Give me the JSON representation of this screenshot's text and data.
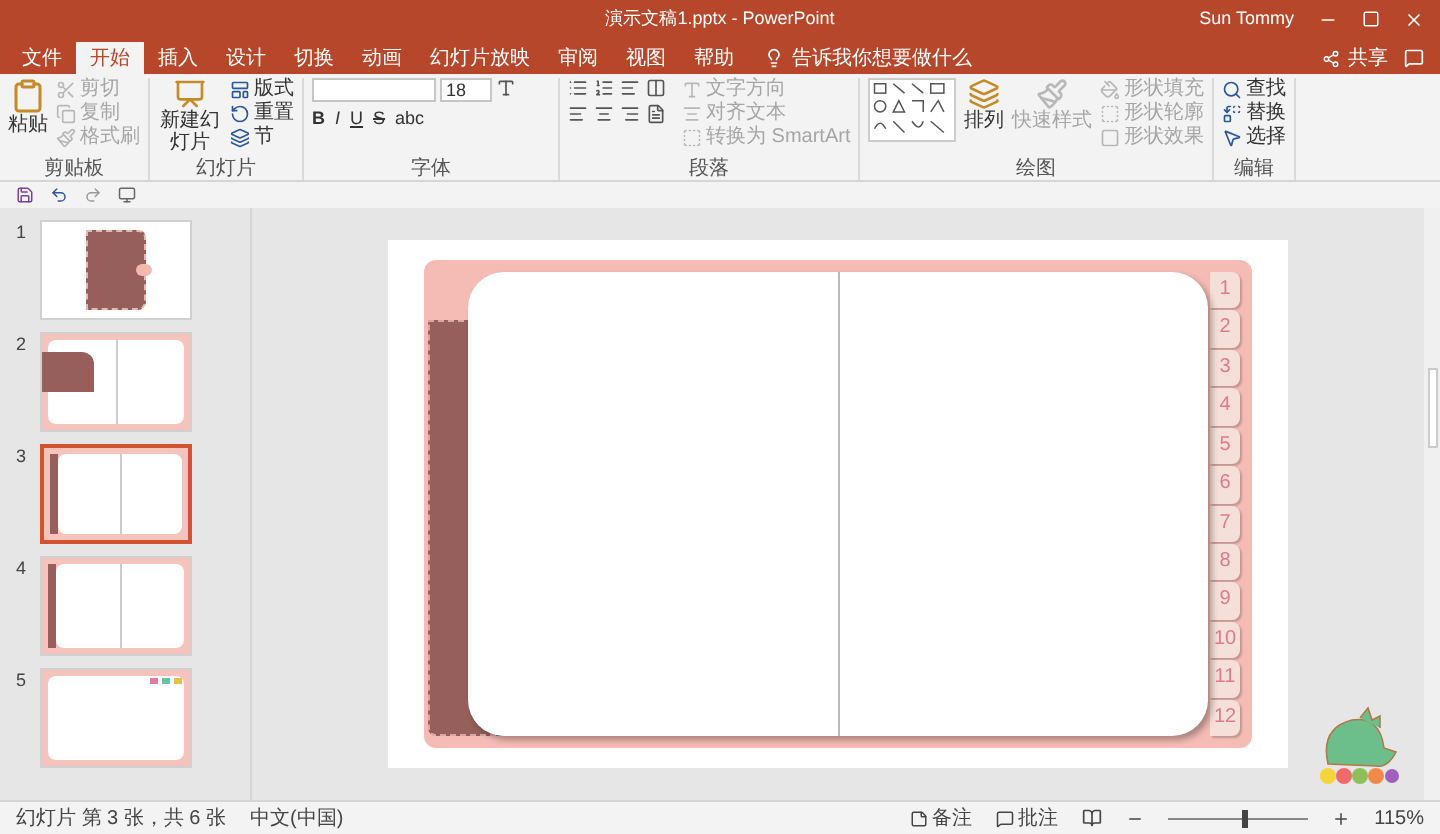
{
  "window": {
    "title": "演示文稿1.pptx - PowerPoint",
    "user": "Sun Tommy"
  },
  "ribbon_tabs": [
    {
      "label": "文件",
      "selected": false
    },
    {
      "label": "开始",
      "selected": true
    },
    {
      "label": "插入",
      "selected": false
    },
    {
      "label": "设计",
      "selected": false
    },
    {
      "label": "切换",
      "selected": false
    },
    {
      "label": "动画",
      "selected": false
    },
    {
      "label": "幻灯片放映",
      "selected": false
    },
    {
      "label": "审阅",
      "selected": false
    },
    {
      "label": "视图",
      "selected": false
    },
    {
      "label": "帮助",
      "selected": false
    }
  ],
  "tell_me": "告诉我你想要做什么",
  "share": "共享",
  "ribbon": {
    "clipboard": {
      "label": "剪贴板",
      "paste": "粘贴",
      "items": [
        {
          "label": "剪切",
          "disabled": true
        },
        {
          "label": "复制",
          "disabled": true
        },
        {
          "label": "格式刷",
          "disabled": true
        }
      ]
    },
    "slides": {
      "label": "幻灯片",
      "new_slide": "新建幻灯片",
      "items": [
        {
          "label": "版式",
          "disabled": false
        },
        {
          "label": "重置",
          "disabled": false
        },
        {
          "label": "节",
          "disabled": false
        }
      ]
    },
    "font": {
      "label": "字体",
      "size": "18",
      "buttons": [
        "B",
        "I",
        "U",
        "S",
        "abc"
      ]
    },
    "paragraph": {
      "label": "段落",
      "items": [
        {
          "label": "文字方向",
          "disabled": true
        },
        {
          "label": "对齐文本",
          "disabled": true
        },
        {
          "label": "转换为 SmartArt",
          "disabled": true
        }
      ]
    },
    "drawing": {
      "label": "绘图",
      "arrange": "排列",
      "quick_styles": {
        "label": "快速样式",
        "disabled": true
      },
      "items": [
        {
          "label": "形状填充",
          "disabled": true
        },
        {
          "label": "形状轮廓",
          "disabled": true
        },
        {
          "label": "形状效果",
          "disabled": true
        }
      ]
    },
    "editing": {
      "label": "编辑",
      "items": [
        {
          "label": "查找",
          "disabled": false
        },
        {
          "label": "替换",
          "disabled": false
        },
        {
          "label": "选择",
          "disabled": false
        }
      ]
    }
  },
  "slides_pane": {
    "slides": [
      {
        "number": "1",
        "kind": "cover",
        "selected": false
      },
      {
        "number": "2",
        "kind": "flap",
        "selected": false
      },
      {
        "number": "3",
        "kind": "spread",
        "selected": true
      },
      {
        "number": "4",
        "kind": "spread",
        "selected": false
      },
      {
        "number": "5",
        "kind": "stickers",
        "selected": false
      }
    ]
  },
  "slide": {
    "tabs": [
      "1",
      "2",
      "3",
      "4",
      "5",
      "6",
      "7",
      "8",
      "9",
      "10",
      "11",
      "12"
    ]
  },
  "status_bar": {
    "slide_info": "幻灯片 第 3 张，共 6 张",
    "language": "中文(中国)",
    "notes": "备注",
    "comments": "批注",
    "zoom": "115%",
    "level": 0.55
  }
}
